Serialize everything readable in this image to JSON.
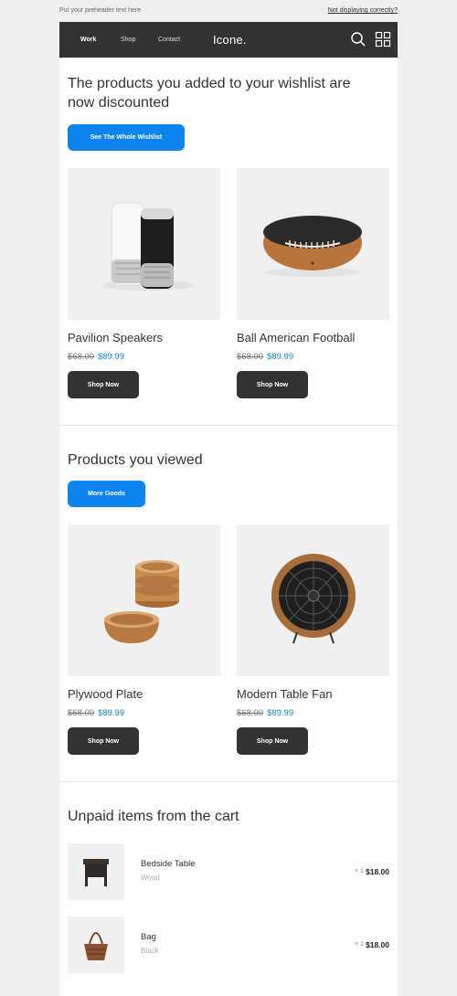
{
  "preheader": {
    "text": "Put your preheader text here",
    "link": "Not displaying correctly?"
  },
  "header": {
    "nav": [
      "Work",
      "Shop",
      "Contact"
    ],
    "logo": "Icone.",
    "icons": [
      "search-icon",
      "grid-menu-icon"
    ]
  },
  "wishlist": {
    "title": "The products you added to your wishlist are now discounted",
    "button": "See The Whole Wishlist",
    "products": [
      {
        "name": "Pavilion Speakers",
        "old_price": "$68.00",
        "new_price": "$89.99",
        "button": "Shop Now"
      },
      {
        "name": "Ball American Football",
        "old_price": "$68.00",
        "new_price": "$89.99",
        "button": "Shop Now"
      }
    ]
  },
  "viewed": {
    "title": "Products you viewed",
    "button": "More Goods",
    "products": [
      {
        "name": "Plywood Plate",
        "old_price": "$68.00",
        "new_price": "$89.99",
        "button": "Shop Now"
      },
      {
        "name": "Modern Table Fan",
        "old_price": "$68.00",
        "new_price": "$89.99",
        "button": "Shop Now"
      }
    ]
  },
  "cart": {
    "title": "Unpaid items from the cart",
    "items": [
      {
        "name": "Bedside Table",
        "variant": "Wood",
        "qty": "× 1",
        "price": "$18.00"
      },
      {
        "name": "Bag",
        "variant": "Black",
        "qty": "× 1",
        "price": "$18.00"
      }
    ]
  },
  "colors": {
    "accent_blue": "#0c84ef",
    "dark": "#333333",
    "price_blue": "#1a86d6"
  }
}
